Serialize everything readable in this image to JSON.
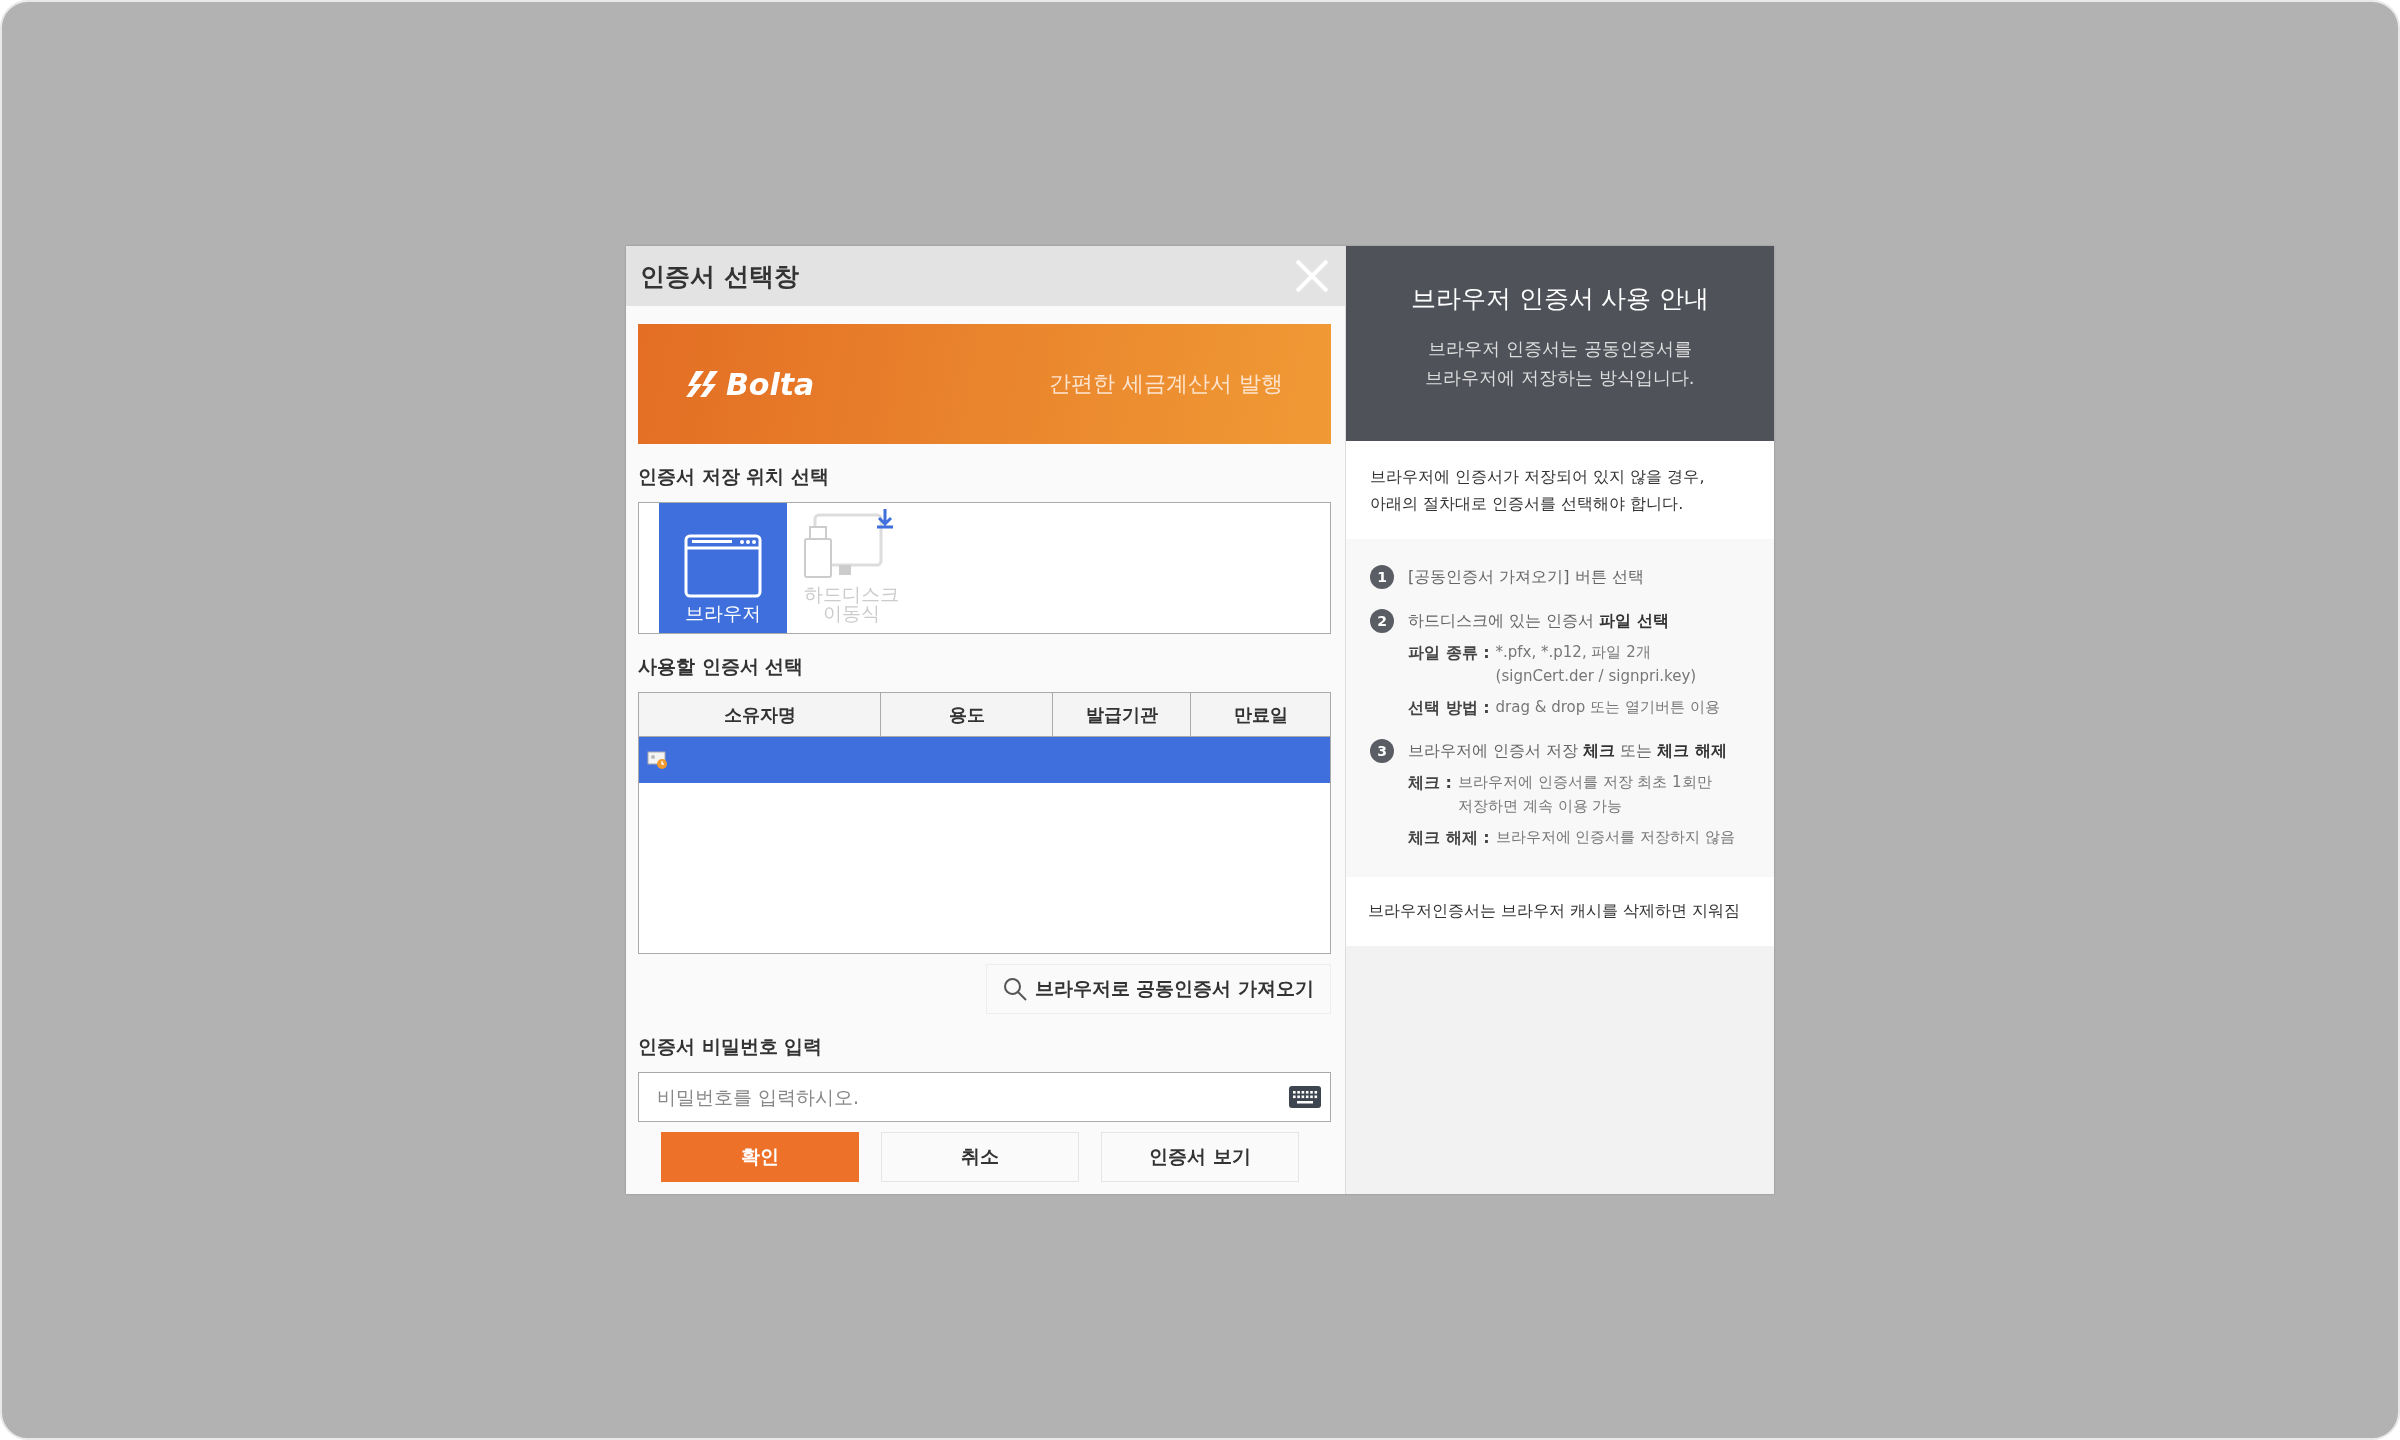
{
  "window": {
    "title": "인증서 선택창"
  },
  "banner": {
    "logo": "Bolta",
    "tagline": "간편한 세금계산서 발행"
  },
  "storage": {
    "label": "인증서 저장 위치 선택",
    "options": [
      {
        "kind": "browser",
        "label": "브라우저",
        "selected": true
      },
      {
        "kind": "disk",
        "label": "하드디스크 이동식",
        "selected": false
      }
    ]
  },
  "cert_table": {
    "label": "사용할 인증서 선택",
    "columns": [
      "소유자명",
      "용도",
      "발급기관",
      "만료일"
    ],
    "rows": [
      {
        "selected": true
      }
    ]
  },
  "import_button": {
    "label": "브라우저로 공동인증서 가져오기"
  },
  "password": {
    "label": "인증서 비밀번호 입력",
    "placeholder": "비밀번호를 입력하시오."
  },
  "buttons": [
    {
      "label": "확인",
      "kind": "primary"
    },
    {
      "label": "취소",
      "kind": "plain"
    },
    {
      "label": "인증서 보기",
      "kind": "plain"
    }
  ],
  "guide": {
    "title": "브라우저 인증서 사용 안내",
    "subtitle": [
      "브라우저 인증서는 공동인증서를",
      "브라우저에 저장하는 방식입니다."
    ],
    "intro": [
      "브라우저에 인증서가 저장되어 있지 않을 경우,",
      "아래의 절차대로 인증서를 선택해야 합니다."
    ],
    "steps": [
      {
        "number": "1",
        "text": "[공동인증서 가져오기] 버튼 선택"
      },
      {
        "number": "2",
        "text": "하드디스크에 있는 인증서 **파일 선택**",
        "details": [
          {
            "term": "파일 종류 :",
            "lines": [
              "*.pfx, *.p12, 파일 2개",
              "(signCert.der / signpri.key)"
            ]
          },
          {
            "term": "선택 방법 :",
            "lines": [
              "drag & drop 또는 열기버튼 이용"
            ]
          }
        ]
      },
      {
        "number": "3",
        "text": "브라우저에 인증서 저장 **체크** 또는 **체크 해제**",
        "details": [
          {
            "term": "체크 :",
            "lines": [
              "브라우저에 인증서를 저장 최초 1회만",
              "저장하면 계속 이용 가능"
            ]
          },
          {
            "term": "체크 해제 :",
            "lines": [
              "브라우저에 인증서를 저장하지 않음"
            ]
          }
        ]
      }
    ],
    "note": "브라우저인증서는 브라우저 캐시를 삭제하면 지워짐"
  }
}
